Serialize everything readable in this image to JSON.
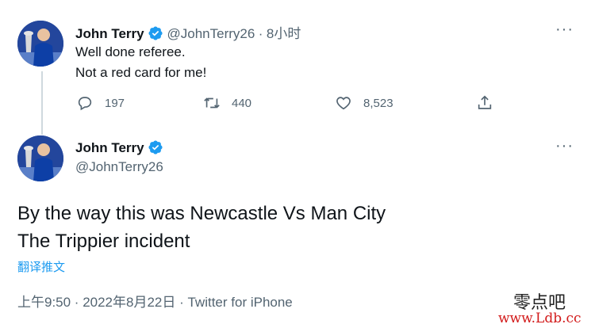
{
  "reply_tweet": {
    "author_name": "John Terry",
    "author_handle": "@JohnTerry26",
    "separator": "·",
    "time": "8小时",
    "text_line1": "Well done referee.",
    "text_line2": "Not a red card for me!",
    "more": "···",
    "actions": {
      "replies": "197",
      "retweets": "440",
      "likes": "8,523"
    }
  },
  "main_tweet": {
    "author_name": "John Terry",
    "author_handle": "@JohnTerry26",
    "more": "···",
    "text_line1": "By the way this was Newcastle Vs Man City",
    "text_line2": "The Trippier incident",
    "translate_label": "翻译推文",
    "meta": "上午9:50 · 2022年8月22日 · Twitter for iPhone"
  },
  "watermark": {
    "line1": "零点吧",
    "line2": "www.Ldb.cc"
  },
  "colors": {
    "verified": "#1d9bf0",
    "secondary_text": "#536471",
    "link": "#1d9bf0"
  }
}
